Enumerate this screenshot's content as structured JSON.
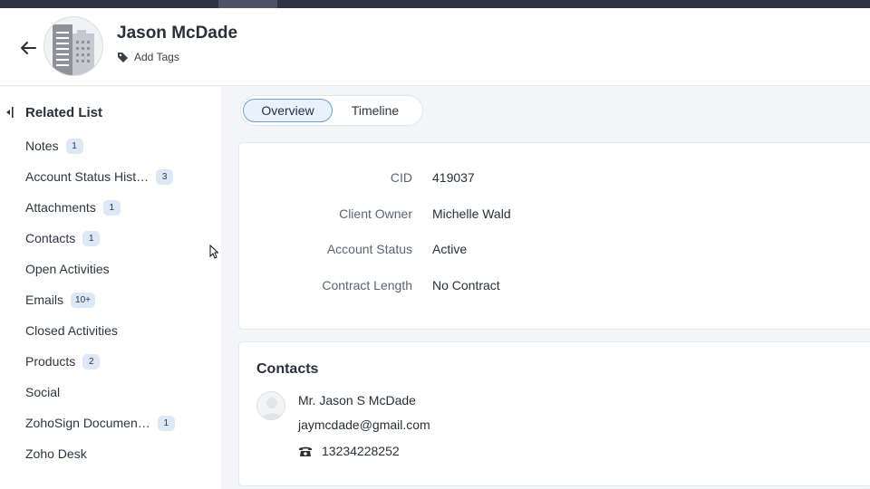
{
  "record": {
    "name": "Jason McDade",
    "add_tags_label": "Add Tags"
  },
  "related_list": {
    "title": "Related List",
    "items": [
      {
        "label": "Notes",
        "count": "1"
      },
      {
        "label": "Account Status Hist…",
        "count": "3"
      },
      {
        "label": "Attachments",
        "count": "1"
      },
      {
        "label": "Contacts",
        "count": "1"
      },
      {
        "label": "Open Activities",
        "count": ""
      },
      {
        "label": "Emails",
        "count": "10+"
      },
      {
        "label": "Closed Activities",
        "count": ""
      },
      {
        "label": "Products",
        "count": "2"
      },
      {
        "label": "Social",
        "count": ""
      },
      {
        "label": "ZohoSign Documen…",
        "count": "1"
      },
      {
        "label": "Zoho Desk",
        "count": ""
      }
    ]
  },
  "tabs": {
    "overview": "Overview",
    "timeline": "Timeline",
    "active": "Overview"
  },
  "overview": {
    "fields": [
      {
        "label": "CID",
        "value": "419037"
      },
      {
        "label": "Client Owner",
        "value": "Michelle Wald"
      },
      {
        "label": "Account Status",
        "value": "Active"
      },
      {
        "label": "Contract Length",
        "value": "No Contract"
      }
    ]
  },
  "contacts": {
    "title": "Contacts",
    "items": [
      {
        "name": "Mr. Jason S McDade",
        "email": "jaymcdade@gmail.com",
        "phone": "13234228252"
      }
    ]
  },
  "icons": {
    "back": "back-arrow-icon",
    "tag": "tag-icon",
    "collapse": "collapse-sidebar-icon",
    "phone": "phone-icon",
    "avatar": "building-icon",
    "contact_avatar": "person-icon"
  },
  "colors": {
    "accent": "#6a9ed8",
    "badge_bg": "#dde8f7",
    "top_bar": "#2e3442"
  }
}
